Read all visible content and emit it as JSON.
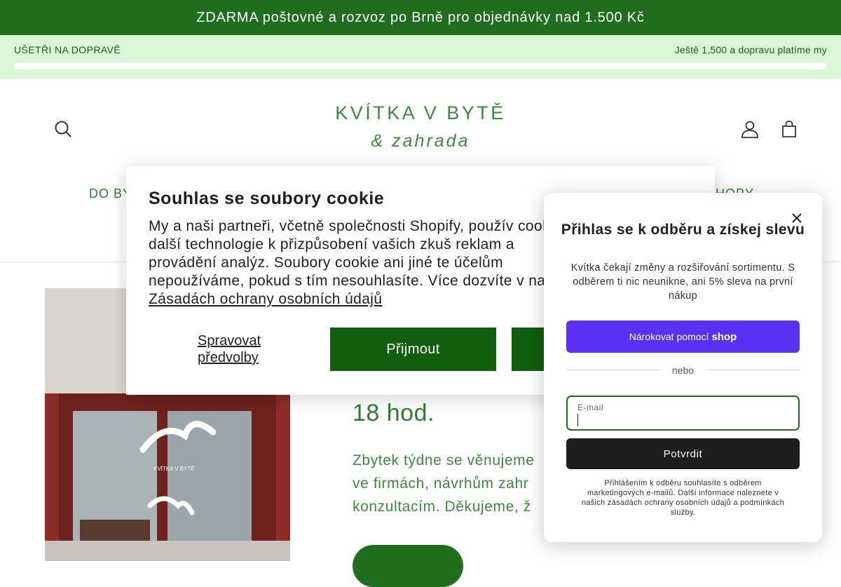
{
  "announcement": "ZDARMA poštovné a rozvoz po Brně pro objednávky nad 1.500 Kč",
  "shipping_bar": {
    "left_label": "UŠETŘI NA DOPRAVĚ ",
    "right_label": "Ještě 1,500 a dopravu platíme my ",
    "progress": 0
  },
  "logo": {
    "line1": "KVÍTKA V BYTĚ",
    "line2": "& zahrada"
  },
  "nav": {
    "item_left": "DO BY",
    "item_right": "HOPY"
  },
  "hero": {
    "heading": "18 hod.",
    "text_lines": [
      "Zbytek týdne se věnujeme",
      "ve firmách, návrhům zahr",
      "konzultacím. Děkujeme, ž"
    ]
  },
  "cookie": {
    "title": "Souhlas se soubory cookie",
    "body": "My a naši partneři, včetně společnosti Shopify, použív cookie a další technologie k přizpůsobení vašich zkuš reklam a provádění analýz. Soubory cookie ani jiné te účelům nepoužíváme, pokud s tím nesouhlasíte. Více dozvíte v našich ",
    "policy_link": "Zásadách ochrany osobních údajů",
    "manage_label": "Spravovat předvolby",
    "accept_label": "Přijmout"
  },
  "popup": {
    "title": "Přihlas se k odběru a získej slevu",
    "description": "Kvítka čekají změny a rozšiřování sortimentu. S odběrem ti nic neunikne, ani 5% sleva na první nákup",
    "shop_button_prefix": "Nárokovat pomocí",
    "shop_button_brand": "shop",
    "divider": "nebo",
    "email_label": "E-mail",
    "email_value": "",
    "submit_label": "Potvrdit",
    "legal": "Přihlášením k odběru souhlasíte s odběrem marketingových e-mailů. Další informace naleznete v našich zásadách ochrany osobních údajů a podmínkách služby."
  },
  "colors": {
    "brand_green": "#1f6e1e",
    "light_green": "#d9f7d4",
    "shop_purple": "#5a31f4"
  },
  "icons": [
    "search-icon",
    "account-icon",
    "cart-icon",
    "close-icon"
  ]
}
